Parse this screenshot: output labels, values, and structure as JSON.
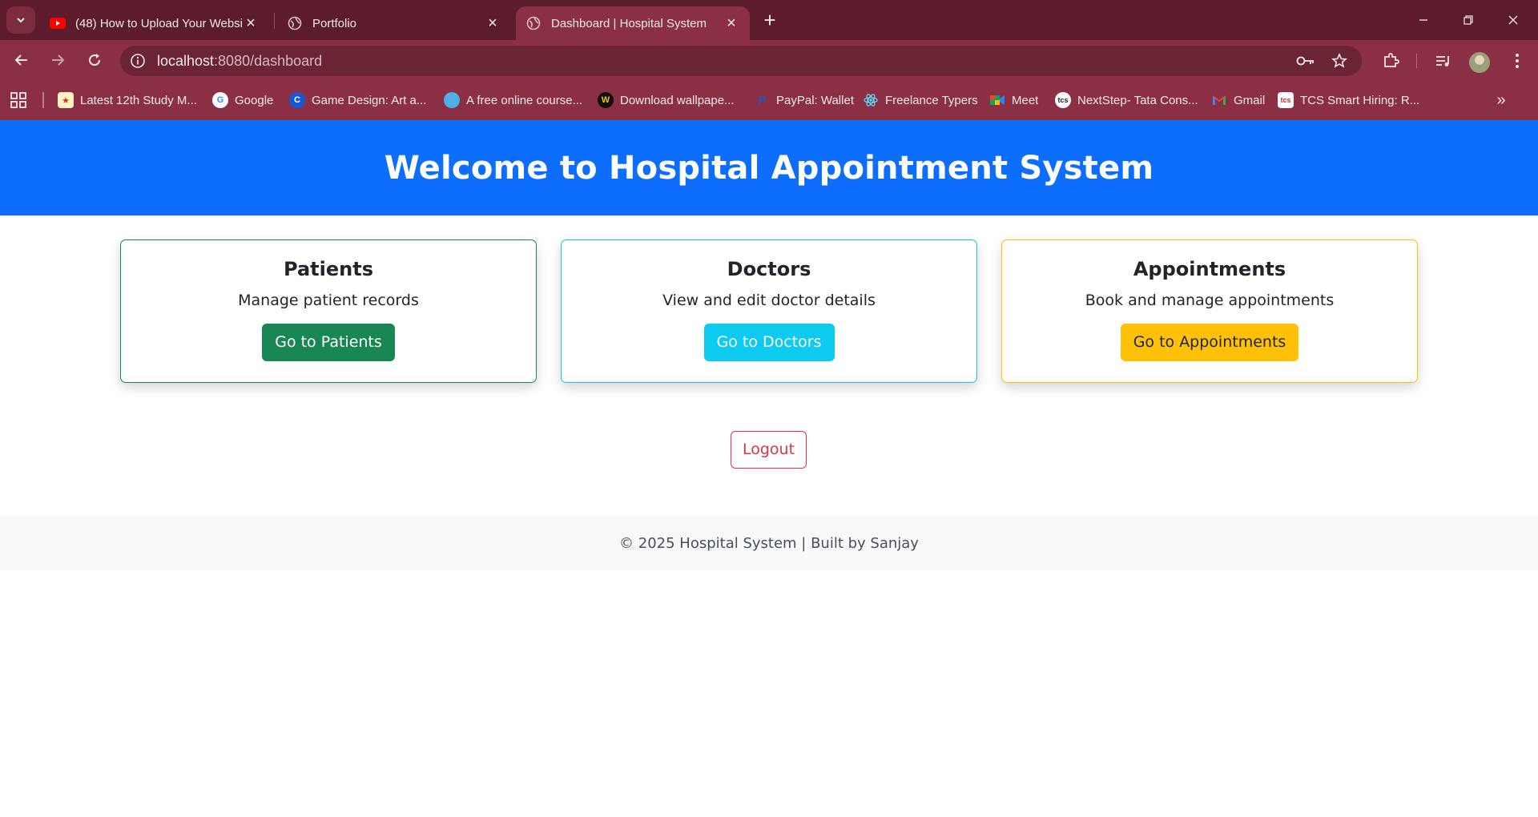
{
  "browser": {
    "tabs": [
      {
        "title": "(48) How to Upload Your Websi",
        "favicon": "youtube-icon"
      },
      {
        "title": "Portfolio",
        "favicon": "globe-icon"
      },
      {
        "title": "Dashboard | Hospital System",
        "favicon": "globe-icon",
        "active": true
      }
    ],
    "url_host": "localhost",
    "url_path": ":8080/dashboard",
    "bookmarks": [
      {
        "label": "Latest 12th Study M..."
      },
      {
        "label": "Google"
      },
      {
        "label": "Game Design: Art a..."
      },
      {
        "label": "A free online course..."
      },
      {
        "label": "Download wallpape..."
      },
      {
        "label": "PayPal: Wallet"
      },
      {
        "label": "Freelance Typers"
      },
      {
        "label": "Meet"
      },
      {
        "label": "NextStep- Tata Cons..."
      },
      {
        "label": "Gmail"
      },
      {
        "label": "TCS Smart Hiring: R..."
      }
    ],
    "colors": {
      "frame": "#5c1c2b",
      "toolbar": "#8b3044"
    }
  },
  "hero": {
    "title": "Welcome to Hospital Appointment System"
  },
  "cards": [
    {
      "title": "Patients",
      "description": "Manage patient records",
      "button": "Go to Patients"
    },
    {
      "title": "Doctors",
      "description": "View and edit doctor details",
      "button": "Go to Doctors"
    },
    {
      "title": "Appointments",
      "description": "Book and manage appointments",
      "button": "Go to Appointments"
    }
  ],
  "logout": {
    "label": "Logout"
  },
  "footer": {
    "text": "© 2025 Hospital System | Built by Sanjay"
  },
  "colors": {
    "primary": "#0d6efd",
    "success": "#198754",
    "info": "#0dcaf0",
    "warning": "#ffc107",
    "danger": "#dc3545"
  }
}
